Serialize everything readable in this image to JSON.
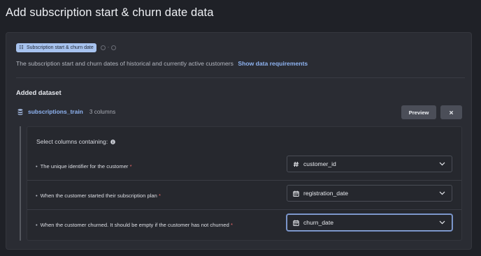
{
  "page": {
    "title": "Add subscription start & churn date data"
  },
  "stepper": {
    "active_label": "Subscription start & churn date",
    "separator": "-"
  },
  "description": {
    "text": "The subscription start and churn dates of historical and currently active customers",
    "link": "Show data requirements"
  },
  "added_dataset": {
    "title": "Added dataset",
    "name": "subscriptions_train",
    "columns": "3 columns",
    "preview_label": "Preview"
  },
  "mapping": {
    "title": "Select columns containing:",
    "rows": [
      {
        "label": "The unique identifier for the customer",
        "required": "*",
        "value": "customer_id",
        "icon": "hash-icon"
      },
      {
        "label": "When the customer started their subscription plan",
        "required": "*",
        "value": "registration_date",
        "icon": "calendar-icon"
      },
      {
        "label": "When the customer churned. It should be empty if the customer has not churned",
        "required": "*",
        "value": "churn_date",
        "icon": "calendar-icon"
      }
    ]
  },
  "colors": {
    "background": "#1f2127",
    "panel": "#2a2c33",
    "accent": "#8fb4f2",
    "badge": "#a7c3ef",
    "required": "#ef6a6a"
  }
}
